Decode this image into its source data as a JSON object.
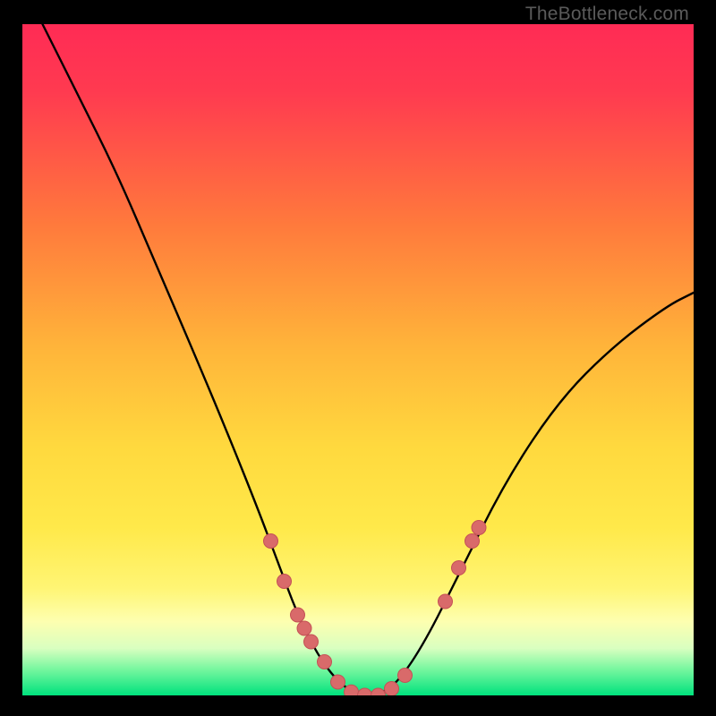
{
  "watermark": "TheBottleneck.com",
  "colors": {
    "black": "#000000",
    "curve": "#000000",
    "marker": "#d96a6a",
    "marker_stroke": "#c45156",
    "green": "#00e67a",
    "yellow": "#ffe24a",
    "orange": "#ffa63a",
    "red": "#ff2b49",
    "pink": "#ff3a63"
  },
  "chart_data": {
    "type": "line",
    "title": "",
    "xlabel": "",
    "ylabel": "",
    "xlim": [
      0,
      100
    ],
    "ylim": [
      0,
      100
    ],
    "annotations": [
      "TheBottleneck.com"
    ],
    "curve": [
      {
        "x": 3,
        "y": 100
      },
      {
        "x": 8,
        "y": 90
      },
      {
        "x": 14,
        "y": 78
      },
      {
        "x": 20,
        "y": 64
      },
      {
        "x": 26,
        "y": 50
      },
      {
        "x": 31,
        "y": 38
      },
      {
        "x": 35,
        "y": 28
      },
      {
        "x": 38,
        "y": 20
      },
      {
        "x": 41,
        "y": 12
      },
      {
        "x": 44,
        "y": 6
      },
      {
        "x": 47,
        "y": 2
      },
      {
        "x": 50,
        "y": 0
      },
      {
        "x": 53,
        "y": 0
      },
      {
        "x": 56,
        "y": 2
      },
      {
        "x": 60,
        "y": 8
      },
      {
        "x": 65,
        "y": 18
      },
      {
        "x": 72,
        "y": 32
      },
      {
        "x": 80,
        "y": 44
      },
      {
        "x": 88,
        "y": 52
      },
      {
        "x": 96,
        "y": 58
      },
      {
        "x": 100,
        "y": 60
      }
    ],
    "markers": [
      {
        "x": 37,
        "y": 23
      },
      {
        "x": 39,
        "y": 17
      },
      {
        "x": 41,
        "y": 12
      },
      {
        "x": 42,
        "y": 10
      },
      {
        "x": 43,
        "y": 8
      },
      {
        "x": 45,
        "y": 5
      },
      {
        "x": 47,
        "y": 2
      },
      {
        "x": 49,
        "y": 0.5
      },
      {
        "x": 51,
        "y": 0
      },
      {
        "x": 53,
        "y": 0
      },
      {
        "x": 55,
        "y": 1
      },
      {
        "x": 57,
        "y": 3
      },
      {
        "x": 63,
        "y": 14
      },
      {
        "x": 65,
        "y": 19
      },
      {
        "x": 67,
        "y": 23
      },
      {
        "x": 68,
        "y": 25
      }
    ]
  }
}
